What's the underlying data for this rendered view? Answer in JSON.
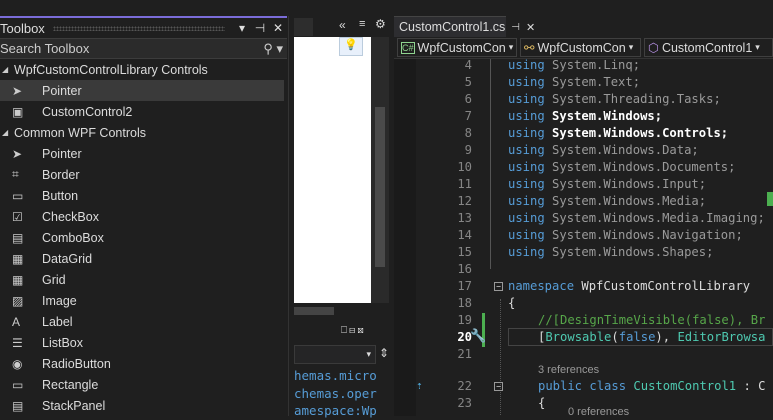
{
  "toolbox": {
    "title": "Toolbox",
    "search_placeholder": "Search Toolbox",
    "categories": [
      {
        "label": "WpfCustomControlLibrary Controls",
        "items": [
          {
            "label": "Pointer",
            "icon": "pointer-icon"
          },
          {
            "label": "CustomControl2",
            "icon": "custom-control-icon"
          }
        ]
      },
      {
        "label": "Common WPF Controls",
        "items": [
          {
            "label": "Pointer",
            "icon": "pointer-icon"
          },
          {
            "label": "Border",
            "icon": "border-icon"
          },
          {
            "label": "Button",
            "icon": "button-icon"
          },
          {
            "label": "CheckBox",
            "icon": "checkbox-icon"
          },
          {
            "label": "ComboBox",
            "icon": "combobox-icon"
          },
          {
            "label": "DataGrid",
            "icon": "datagrid-icon"
          },
          {
            "label": "Grid",
            "icon": "grid-icon"
          },
          {
            "label": "Image",
            "icon": "image-icon"
          },
          {
            "label": "Label",
            "icon": "label-icon"
          },
          {
            "label": "ListBox",
            "icon": "listbox-icon"
          },
          {
            "label": "RadioButton",
            "icon": "radiobutton-icon"
          },
          {
            "label": "Rectangle",
            "icon": "rectangle-icon"
          },
          {
            "label": "StackPanel",
            "icon": "stackpanel-icon"
          }
        ]
      }
    ]
  },
  "xaml": {
    "lines": [
      "hemas.micro",
      "chemas.oper",
      "amespace:Wp"
    ]
  },
  "editor": {
    "tab": "CustomControl1.cs",
    "nav": [
      "WpfCustomCon",
      "WpfCustomCon",
      "CustomControl1"
    ],
    "lines": [
      {
        "n": "4",
        "k": "using",
        "t": " System.Linq;",
        "s": "dim"
      },
      {
        "n": "5",
        "k": "using",
        "t": " System.Text;",
        "s": "dim"
      },
      {
        "n": "6",
        "k": "using",
        "t": " System.Threading.Tasks;",
        "s": "dim"
      },
      {
        "n": "7",
        "k": "using",
        "t": " System.Windows;",
        "s": "br"
      },
      {
        "n": "8",
        "k": "using",
        "t": " System.Windows.Controls;",
        "s": "br"
      },
      {
        "n": "9",
        "k": "using",
        "t": " System.Windows.Data;",
        "s": "dim"
      },
      {
        "n": "10",
        "k": "using",
        "t": " System.Windows.Documents;",
        "s": "dim"
      },
      {
        "n": "11",
        "k": "using",
        "t": " System.Windows.Input;",
        "s": "dim"
      },
      {
        "n": "12",
        "k": "using",
        "t": " System.Windows.Media;",
        "s": "dim"
      },
      {
        "n": "13",
        "k": "using",
        "t": " System.Windows.Media.Imaging;",
        "s": "dim"
      },
      {
        "n": "14",
        "k": "using",
        "t": " System.Windows.Navigation;",
        "s": "dim"
      },
      {
        "n": "15",
        "k": "using",
        "t": " System.Windows.Shapes;",
        "s": "dim"
      }
    ],
    "l16": "16",
    "l17": "17",
    "ns_kw": "namespace",
    "ns_name": " WpfCustomControlLibrary",
    "l18": "18",
    "brace": "{",
    "l19": "19",
    "comment": "//[DesignTimeVisible(false), Br",
    "l20": "20",
    "attr_a": "[",
    "attr_b": "Browsable",
    "attr_c": "(",
    "attr_d": "false",
    "attr_e": "), ",
    "attr_f": "EditorBrowsa",
    "l21": "21",
    "refs3": "3 references",
    "l22": "22",
    "pub": "public",
    "cls": " class ",
    "cname": "CustomControl1",
    "colon": " : C",
    "l23": "23",
    "refs0": "0 references"
  }
}
